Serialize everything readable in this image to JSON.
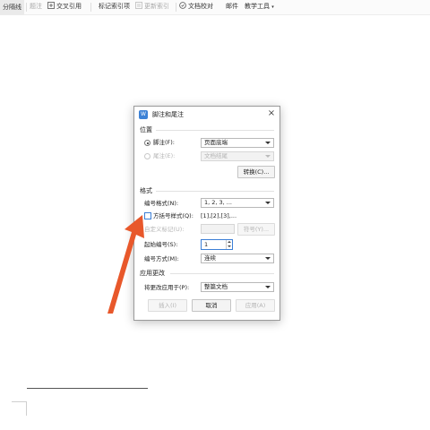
{
  "ribbon": {
    "items": [
      {
        "label": "分隔线",
        "state": "active"
      },
      {
        "label": "题注",
        "state": "disabled"
      },
      {
        "label": "交叉引用",
        "state": "normal"
      },
      {
        "label": "标记索引项",
        "state": "normal"
      },
      {
        "label": "更新索引",
        "state": "disabled"
      },
      {
        "label": "文档校对",
        "state": "normal"
      },
      {
        "label": "邮件",
        "state": "normal"
      },
      {
        "label": "教学工具",
        "state": "normal"
      }
    ]
  },
  "dialog": {
    "title": "脚注和尾注",
    "close_symbol": "×",
    "location": {
      "section_label": "位置",
      "footnote": {
        "label": "脚注(F):",
        "value": "页面底端",
        "selected": true
      },
      "endnote": {
        "label": "尾注(E):",
        "value": "文档结尾",
        "selected": false
      },
      "convert_button": "转换(C)..."
    },
    "format": {
      "section_label": "格式",
      "number_format": {
        "label": "编号格式(N):",
        "value": "1, 2, 3, ..."
      },
      "square_bracket": {
        "label": "方括号样式(Q):",
        "value": "[1],[2],[3],...",
        "checked": false
      },
      "custom_mark": {
        "label": "自定义标记(U):",
        "value": ""
      },
      "symbol_button": "符号(Y)...",
      "start_at": {
        "label": "起始编号(S):",
        "value": "1"
      },
      "numbering": {
        "label": "编号方式(M):",
        "value": "连续"
      }
    },
    "apply": {
      "section_label": "应用更改",
      "apply_to": {
        "label": "将更改应用于(P):",
        "value": "整篇文档"
      }
    },
    "buttons": {
      "insert": "插入(I)",
      "cancel": "取消",
      "apply": "应用(A)"
    }
  },
  "annotation": {
    "color": "#e8582b",
    "icon": "arrow-icon"
  }
}
